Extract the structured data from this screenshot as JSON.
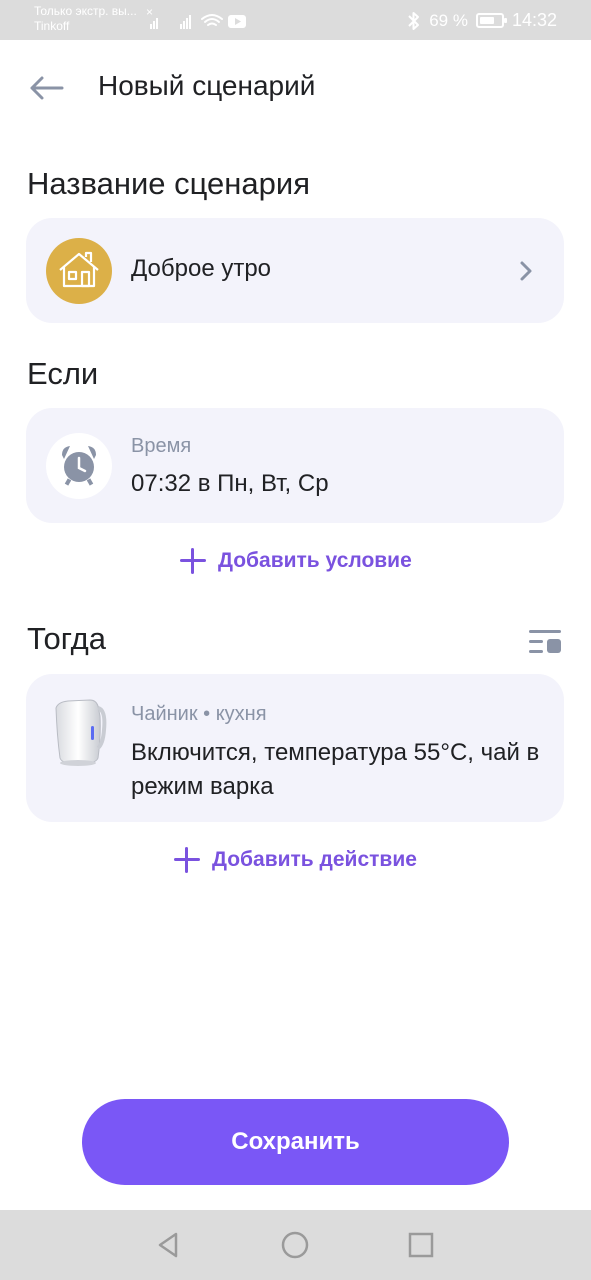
{
  "status_bar": {
    "notification_line1": "Только экстр. вы...",
    "notification_line2": "Tinkoff",
    "notification_close": "×",
    "battery_percent": "69 %",
    "battery_level": 0.69,
    "time": "14:32"
  },
  "header": {
    "back_icon": "arrow-left-icon",
    "title": "Новый сценарий"
  },
  "name_section": {
    "title": "Название сценария",
    "icon": "house-icon",
    "value": "Доброе утро"
  },
  "if_section": {
    "title": "Если",
    "condition": {
      "icon": "alarm-clock-icon",
      "type": "Время",
      "value": "07:32 в Пн, Вт, Ср"
    },
    "add_label": "Добавить условие"
  },
  "then_section": {
    "title": "Тогда",
    "action": {
      "icon": "kettle-icon",
      "device": "Чайник • кухня",
      "description": "Включится, температура 55°C, чай в режим варка"
    },
    "add_label": "Добавить действие"
  },
  "save_button": "Сохранить",
  "colors": {
    "accent": "#7a57f6",
    "link": "#7a52df",
    "card_bg": "#f3f3fb",
    "house_badge": "#dcb048"
  }
}
